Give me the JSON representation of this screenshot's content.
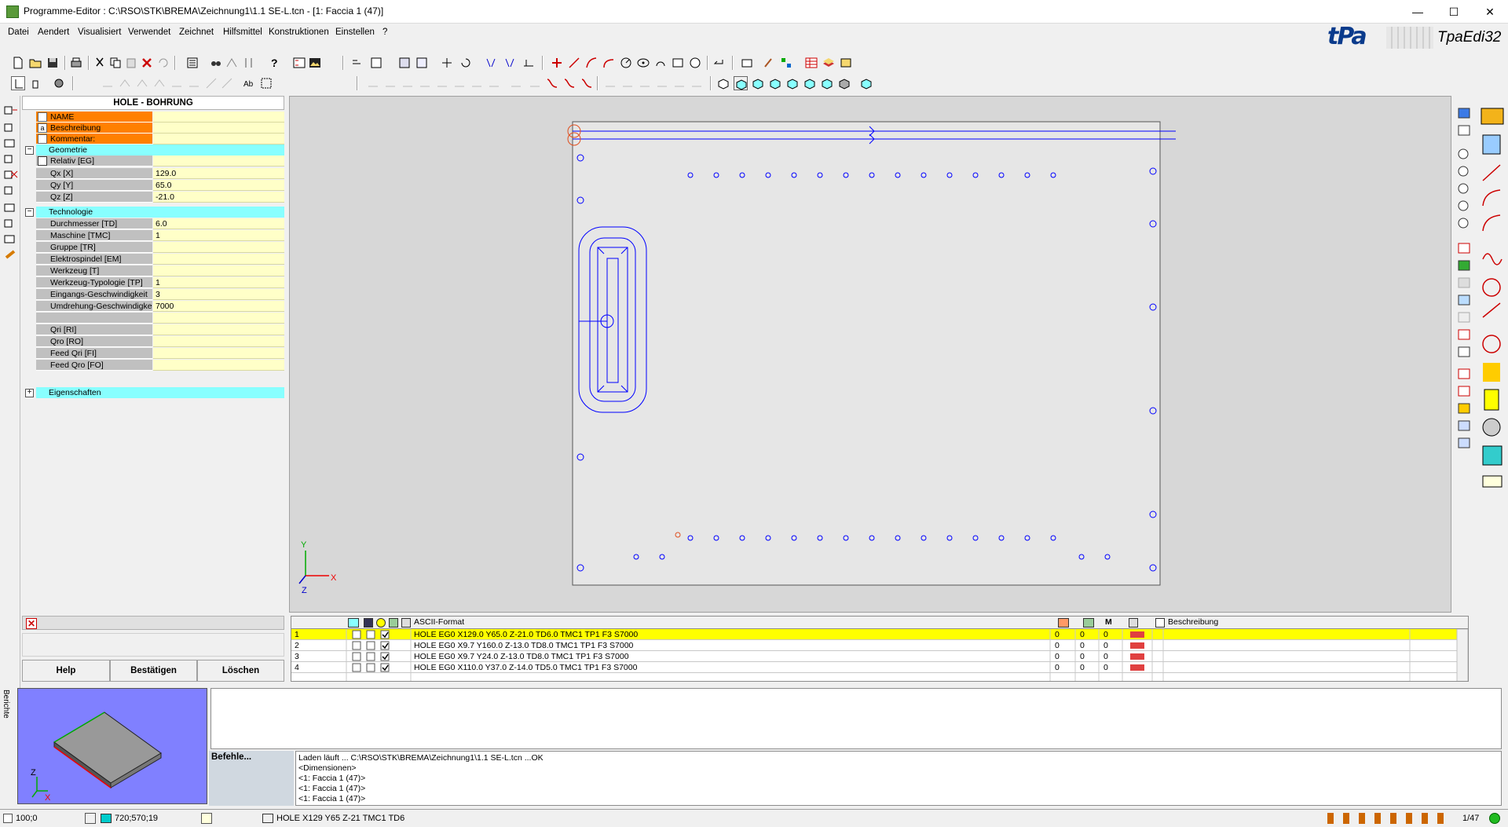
{
  "window": {
    "title": "Programme-Editor : C:\\RSO\\STK\\BREMA\\Zeichnung1\\1.1 SE-L.tcn - [1: Faccia 1 (47)]",
    "minimize": "—",
    "maximize": "☐",
    "close": "✕"
  },
  "menu": [
    "Datei",
    "Aendert",
    "Visualisiert",
    "Verwendet",
    "Zeichnet",
    "Hilfsmittel",
    "Konstruktionen",
    "Einstellen",
    "?"
  ],
  "brand": {
    "logo": "tPa",
    "product": "TpaEdi32"
  },
  "panel": {
    "title": "HOLE - BOHRUNG",
    "header_rows": [
      {
        "label": "NAME",
        "value": ""
      },
      {
        "label": "Beschreibung",
        "value": ""
      },
      {
        "label": "Kommentar:",
        "value": ""
      }
    ],
    "geometrie_label": "Geometrie",
    "relativ": {
      "label": "Relativ [EG]",
      "value": ""
    },
    "geometrie_rows": [
      {
        "label": "Qx [X]",
        "value": "129.0"
      },
      {
        "label": "Qy [Y]",
        "value": "65.0"
      },
      {
        "label": "Qz [Z]",
        "value": "-21.0"
      }
    ],
    "technologie_label": "Technologie",
    "tech_rows": [
      {
        "label": "Durchmesser [TD]",
        "value": "6.0"
      },
      {
        "label": "Maschine [TMC]",
        "value": "1"
      },
      {
        "label": "Gruppe [TR]",
        "value": ""
      },
      {
        "label": "Elektrospindel [EM]",
        "value": ""
      },
      {
        "label": "Werkzeug [T]",
        "value": ""
      },
      {
        "label": "Werkzeug-Typologie [TP]",
        "value": "1"
      },
      {
        "label": "Eingangs-Geschwindigkeit",
        "value": "3"
      },
      {
        "label": "Umdrehung-Geschwindigkeit",
        "value": "7000"
      },
      {
        "label": "",
        "value": ""
      },
      {
        "label": "Qri [RI]",
        "value": ""
      },
      {
        "label": "Qro [RO]",
        "value": ""
      },
      {
        "label": "Feed Qri [FI]",
        "value": ""
      },
      {
        "label": "Feed Qro [FO]",
        "value": ""
      }
    ],
    "eigenschaften_label": "Eigenschaften",
    "buttons": {
      "help": "Help",
      "confirm": "Bestätigen",
      "delete": "Löschen"
    }
  },
  "grid": {
    "col_ascii": "ASCII-Format",
    "col_m": "M",
    "col_desc": "Beschreibung",
    "rows": [
      {
        "num": "1",
        "code": "HOLE EG0 X129.0 Y65.0 Z-21.0 TD6.0 TMC1 TP1 F3 S7000",
        "a": "0",
        "b": "0",
        "c": "0",
        "selected": true
      },
      {
        "num": "2",
        "code": "HOLE EG0 X9.7 Y160.0 Z-13.0 TD8.0 TMC1 TP1 F3 S7000",
        "a": "0",
        "b": "0",
        "c": "0",
        "selected": false
      },
      {
        "num": "3",
        "code": "HOLE EG0 X9.7 Y24.0 Z-13.0 TD8.0 TMC1 TP1 F3 S7000",
        "a": "0",
        "b": "0",
        "c": "0",
        "selected": false
      },
      {
        "num": "4",
        "code": "HOLE EG0 X110.0 Y37.0 Z-14.0 TD5.0 TMC1 TP1 F3 S7000",
        "a": "0",
        "b": "0",
        "c": "0",
        "selected": false
      }
    ]
  },
  "side_label": "Berichte",
  "befehle": "Befehle...",
  "log": [
    "Laden läuft ... C:\\RSO\\STK\\BREMA\\Zeichnung1\\1.1 SE-L.tcn ...OK",
    "<Dimensionen>",
    "<1: Faccia 1 (47)>",
    "<1: Faccia 1 (47)>",
    "<1: Faccia 1 (47)>"
  ],
  "status": {
    "zoom": "100;0",
    "coords": "720;570;19",
    "command": "HOLE X129 Y65 Z-21 TMC1 TD6",
    "count": "1/47"
  },
  "axis": {
    "x": "X",
    "y": "Y",
    "z": "Z"
  },
  "colors": {
    "selected_row": "#ffff00",
    "panel_label": "#ff8000",
    "group": "#88ffff",
    "value_cell": "#ffffc8",
    "canvas": "#d7d7d7",
    "hole": "#0000ff"
  }
}
